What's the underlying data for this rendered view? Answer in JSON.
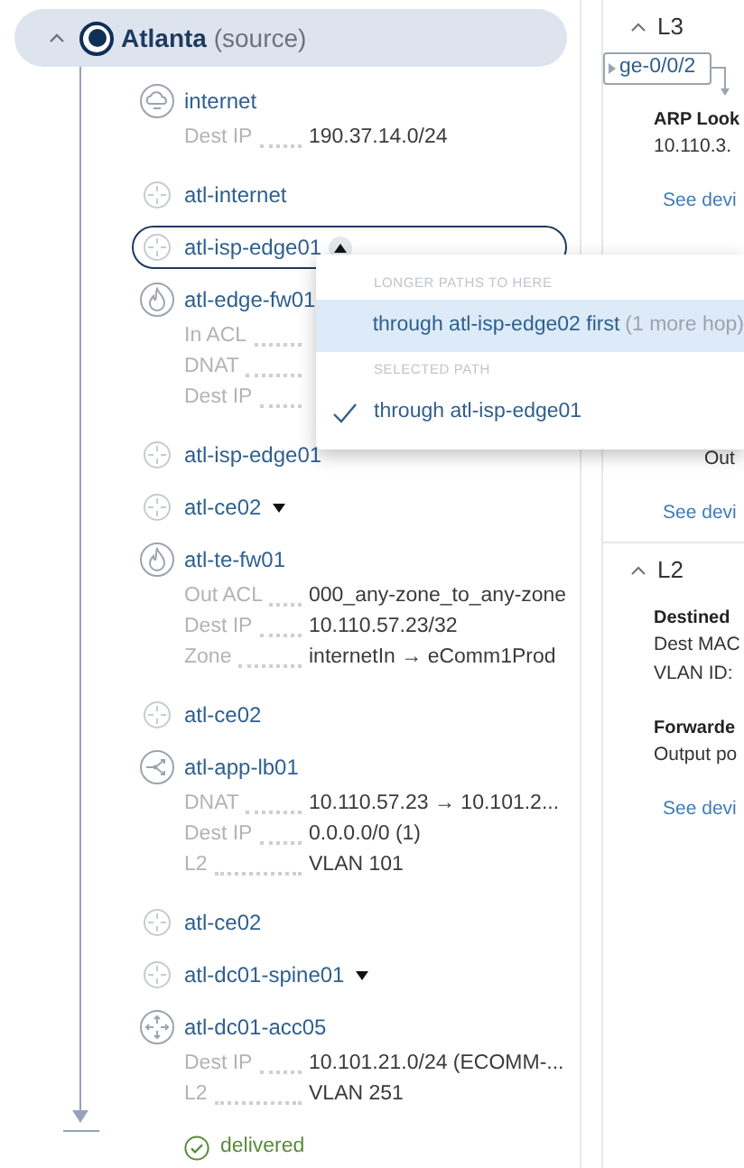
{
  "source": {
    "name": "Atlanta",
    "suffix": "(source)",
    "expanded": true
  },
  "hops": [
    {
      "kind": "cloud",
      "name": "internet",
      "selected": false,
      "details": [
        {
          "label": "Dest IP",
          "value": "190.37.14.0/24"
        }
      ]
    },
    {
      "kind": "router",
      "name": "atl-internet",
      "selected": false
    },
    {
      "kind": "router",
      "name": "atl-isp-edge01",
      "selected": true,
      "menu_open": true
    },
    {
      "kind": "firewall",
      "name": "atl-edge-fw01",
      "selected": false,
      "details": [
        {
          "label": "In ACL"
        },
        {
          "label": "DNAT"
        },
        {
          "label": "Dest IP"
        }
      ]
    },
    {
      "kind": "router",
      "name": "atl-isp-edge01",
      "selected": false
    },
    {
      "kind": "router",
      "name": "atl-ce02",
      "selected": false,
      "menu_open": false
    },
    {
      "kind": "firewall",
      "name": "atl-te-fw01",
      "selected": false,
      "details": [
        {
          "label": "Out ACL",
          "value": "000_any-zone_to_any-zone"
        },
        {
          "label": "Dest IP",
          "value": "10.110.57.23/32"
        },
        {
          "label": "Zone",
          "value": "internetIn → eComm1Prod"
        }
      ]
    },
    {
      "kind": "router",
      "name": "atl-ce02",
      "selected": false
    },
    {
      "kind": "balancer",
      "name": "atl-app-lb01",
      "selected": false,
      "details": [
        {
          "label": "DNAT",
          "value": "10.110.57.23 → 10.101.2..."
        },
        {
          "label": "Dest IP",
          "value": "0.0.0.0/0 (1)"
        },
        {
          "label": "L2",
          "value": "VLAN 101"
        }
      ]
    },
    {
      "kind": "router",
      "name": "atl-ce02",
      "selected": false
    },
    {
      "kind": "router",
      "name": "atl-dc01-spine01",
      "selected": false,
      "menu_open": false
    },
    {
      "kind": "switch",
      "name": "atl-dc01-acc05",
      "selected": false,
      "details": [
        {
          "label": "Dest IP",
          "value": "10.101.21.0/24 (ECOMM-..."
        },
        {
          "label": "L2",
          "value": "VLAN 251"
        }
      ]
    }
  ],
  "result": {
    "label": "delivered"
  },
  "menu": {
    "groups": [
      {
        "heading": "LONGER PATHS TO HERE",
        "options": [
          {
            "label": "through atl-isp-edge02 first",
            "note": "(1 more hop)",
            "selected": false,
            "highlighted": true
          }
        ]
      },
      {
        "heading": "SELECTED PATH",
        "options": [
          {
            "label": "through atl-isp-edge01",
            "selected": true,
            "highlighted": false
          }
        ]
      }
    ]
  },
  "sections": [
    {
      "title": "L3",
      "expanded": true,
      "items": [
        {
          "kind": "interface",
          "text": "ge-0/0/2"
        },
        {
          "kind": "heading",
          "text": "ARP Look"
        },
        {
          "kind": "text",
          "text": "10.110.3."
        },
        {
          "kind": "link",
          "text": "See devi"
        },
        {
          "kind": "covered",
          "text": "Out"
        },
        {
          "kind": "link",
          "text": "See devi"
        }
      ]
    },
    {
      "title": "L2",
      "expanded": true,
      "items": [
        {
          "kind": "heading",
          "text": "Destined"
        },
        {
          "kind": "text",
          "text": "Dest MAC"
        },
        {
          "kind": "text",
          "text": "VLAN ID:"
        },
        {
          "kind": "heading",
          "text": "Forwarde"
        },
        {
          "kind": "text",
          "text": "Output po"
        },
        {
          "kind": "link",
          "text": "See devi"
        }
      ]
    }
  ]
}
